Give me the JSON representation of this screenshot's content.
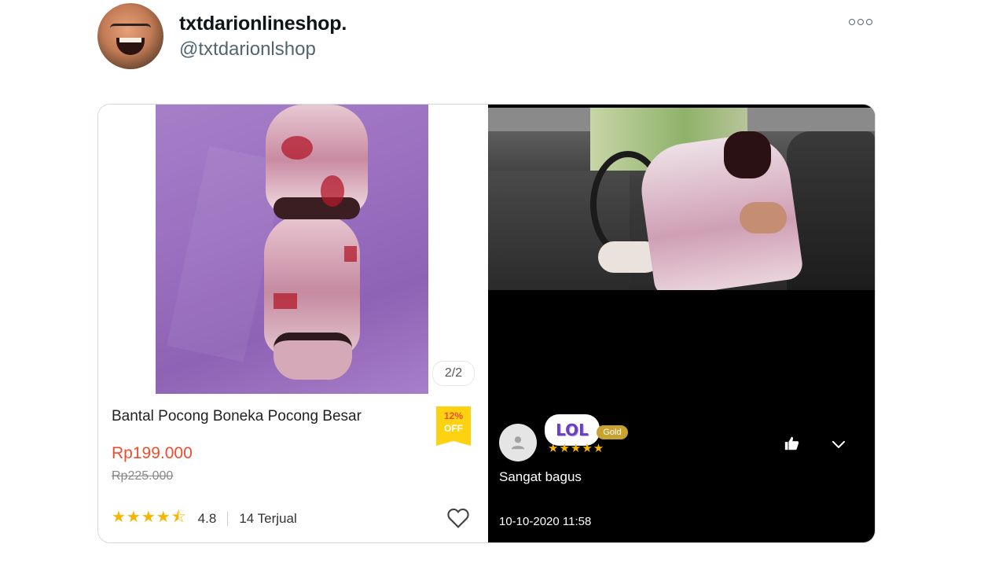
{
  "tweet": {
    "display_name": "txtdarionlineshop.",
    "handle": "@txtdarionlshop",
    "more_icon": "more-horizontal-icon"
  },
  "product": {
    "title": "Bantal Pocong Boneka Pocong Besar",
    "image_counter": "2/2",
    "discount_percent": "12%",
    "discount_label": "OFF",
    "price": "Rp199.000",
    "original_price": "Rp225.000",
    "stars": "★★★★⯪",
    "rating": "4.8",
    "sold": "14 Terjual",
    "favorite_icon": "heart-icon"
  },
  "review": {
    "sticker": "LOL",
    "badge": "Gold",
    "stars": "★★★★★",
    "text": "Sangat bagus",
    "date": "10-10-2020 11:58",
    "like_icon": "thumbs-up-icon",
    "expand_icon": "chevron-down-icon"
  },
  "colors": {
    "price": "#ee4d2d",
    "star": "#f7b500",
    "discount_bg": "#ffd211",
    "review_bg": "#000000"
  }
}
